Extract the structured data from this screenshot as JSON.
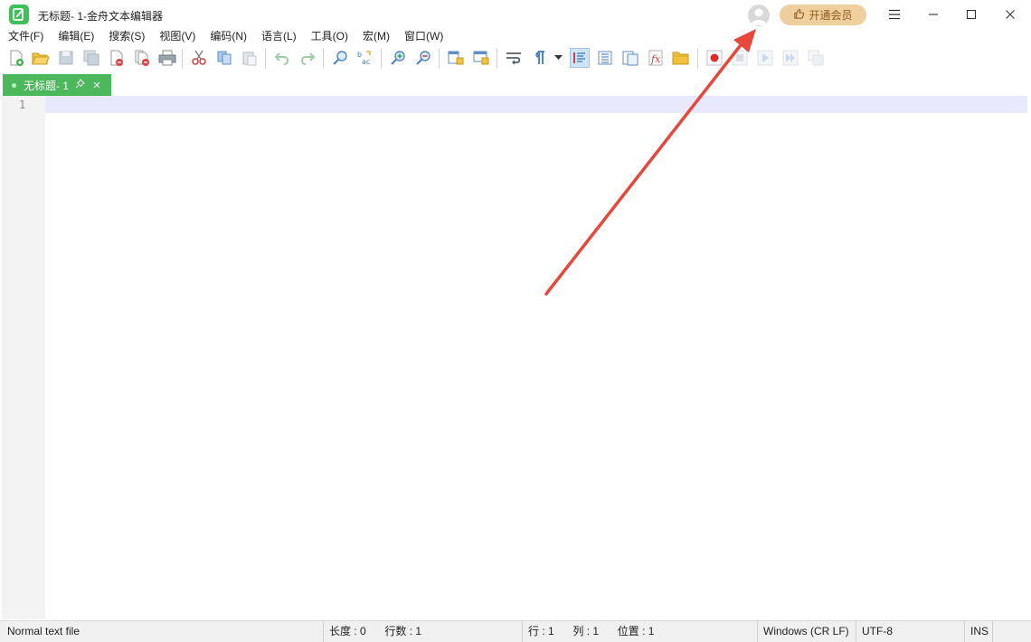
{
  "window": {
    "title": "无标题- 1-金舟文本编辑器",
    "vip_label": "开通会员",
    "controls": [
      "menu-icon",
      "minimize-icon",
      "maximize-icon",
      "close-icon"
    ]
  },
  "menu": {
    "items": [
      "文件(F)",
      "编辑(E)",
      "搜索(S)",
      "视图(V)",
      "编码(N)",
      "语言(L)",
      "工具(O)",
      "宏(M)",
      "窗口(W)"
    ]
  },
  "toolbar": {
    "icons": [
      "new-file-icon",
      "open-file-icon",
      "save-icon",
      "save-all-icon",
      "close-file-icon",
      "close-all-icon",
      "print-icon",
      "cut-icon",
      "copy-icon",
      "paste-icon",
      "undo-icon",
      "redo-icon",
      "find-icon",
      "replace-icon",
      "zoom-in-icon",
      "zoom-out-icon",
      "sync-vertical-icon",
      "sync-horizontal-icon",
      "word-wrap-icon",
      "show-all-chars-icon",
      "dropdown-icon",
      "indent-guide-icon",
      "doc-map-icon",
      "function-list-icon",
      "function-icon",
      "folder-workspace-icon",
      "macro-record-icon",
      "macro-stop-icon",
      "macro-play-icon",
      "macro-run-multiple-icon",
      "macro-save-icon"
    ]
  },
  "tabs": [
    {
      "label": "无标题- 1",
      "active": true
    }
  ],
  "editor": {
    "line_numbers": [
      "1"
    ]
  },
  "status": {
    "file_type": "Normal text file",
    "length_label": "长度 : 0",
    "lines_label": "行数 : 1",
    "row_label": "行 : 1",
    "col_label": "列 : 1",
    "pos_label": "位置 : 1",
    "eol": "Windows (CR LF)",
    "encoding": "UTF-8",
    "mode": "INS"
  },
  "colors": {
    "accent_green": "#4cb85c",
    "vip_bg": "#f0cf9e",
    "current_line": "#e8e8ff",
    "arrow": "#e8473b"
  }
}
